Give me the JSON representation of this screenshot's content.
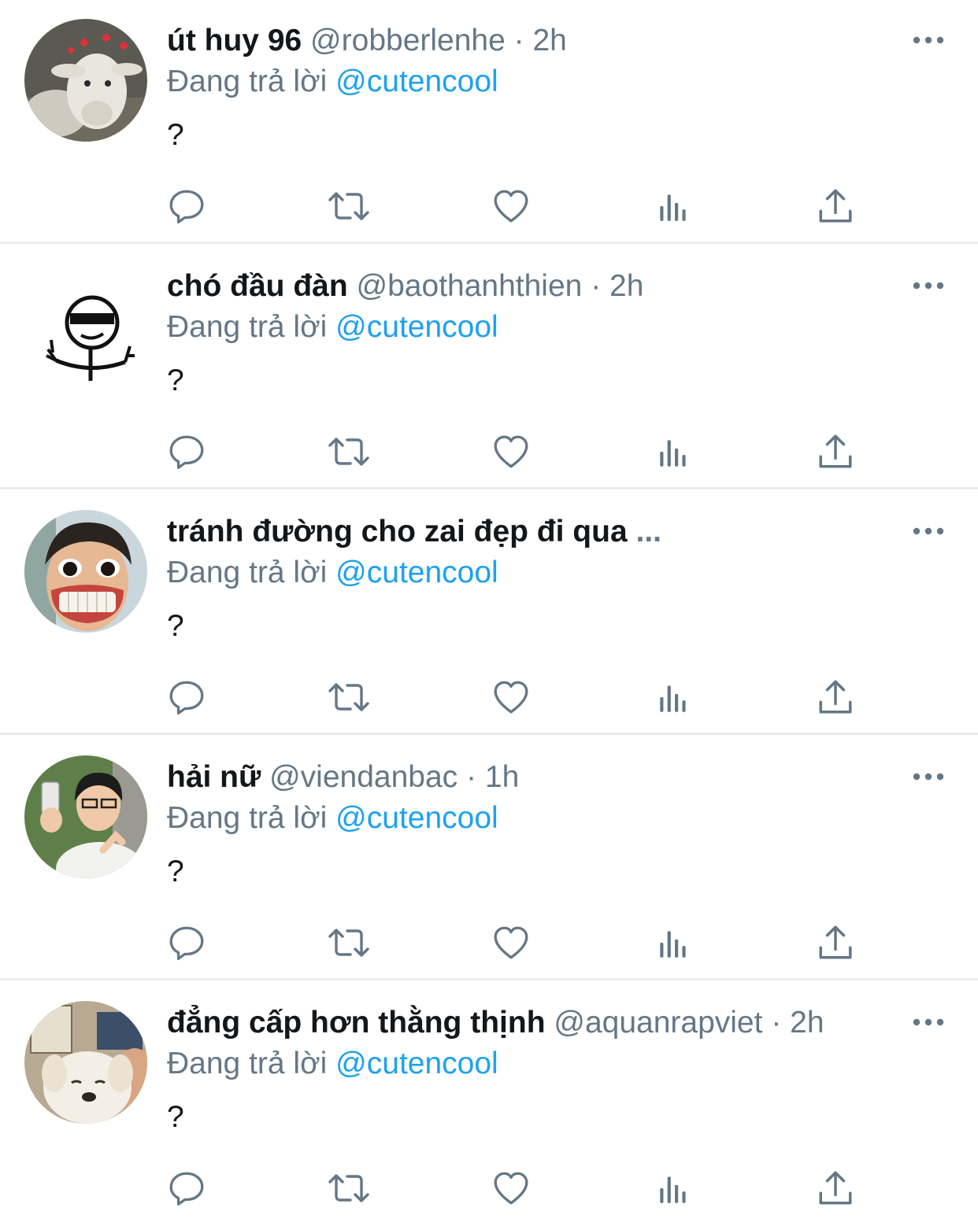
{
  "tweets": [
    {
      "name": "út huy 96",
      "handle": "@robberlenhe",
      "separator": "·",
      "time": "2h",
      "reply_label": "Đang trả lời",
      "reply_to": "@cutencool",
      "text": "?",
      "avatar": "goat-avatar"
    },
    {
      "name": "chó đầu đàn",
      "handle": "@baothanhthien",
      "separator": "·",
      "time": "2h",
      "reply_label": "Đang trả lời",
      "reply_to": "@cutencool",
      "text": "?",
      "avatar": "stickman-sunglasses-avatar"
    },
    {
      "name": "tránh đường cho zai đẹp đi qua",
      "truncation": "...",
      "reply_label": "Đang trả lời",
      "reply_to": "@cutencool",
      "text": "?",
      "avatar": "funny-face-avatar"
    },
    {
      "name": "hải nữ",
      "handle": "@viendanbac",
      "separator": "·",
      "time": "1h",
      "reply_label": "Đang trả lời",
      "reply_to": "@cutencool",
      "text": "?",
      "avatar": "man-with-phone-avatar"
    },
    {
      "name": "đẳng cấp hơn thằng thịnh",
      "handle": "@aquanrapviet",
      "separator": "·",
      "time": "2h",
      "reply_label": "Đang trả lời",
      "reply_to": "@cutencool",
      "text": "?",
      "avatar": "puppy-avatar"
    }
  ],
  "icons": {
    "reply": "reply-icon",
    "retweet": "retweet-icon",
    "like": "heart-icon",
    "stats": "analytics-icon",
    "share": "share-icon",
    "more": "more-options-icon"
  },
  "colors": {
    "accent": "#1da1f2",
    "secondary_text": "#657786",
    "primary_text": "#14171a",
    "divider": "#e8ecef"
  }
}
